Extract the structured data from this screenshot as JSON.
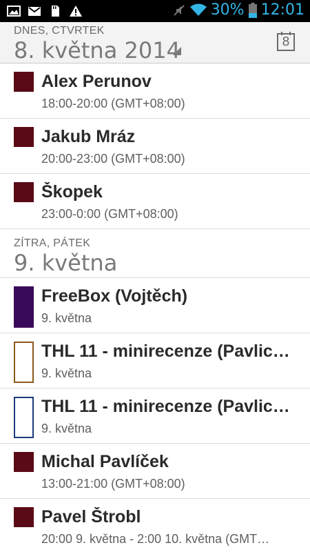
{
  "status_bar": {
    "icons_left": [
      "image-icon",
      "gmail-icon",
      "sd-card-icon",
      "warning-icon"
    ],
    "icons_right": [
      "mute-icon",
      "wifi-icon"
    ],
    "battery_percent": "30%",
    "time": "12:01",
    "accent_color": "#33b5e5"
  },
  "header": {
    "day_label": "DNES, CTVRTEK",
    "date_title": "8. května 2014",
    "today_number": "8"
  },
  "agenda": {
    "today_events": [
      {
        "title": "Alex Perunov",
        "when": "18:00-20:00 (GMT+08:00)",
        "color": "#5a0a16",
        "style": "square"
      },
      {
        "title": "Jakub Mráz",
        "when": "20:00-23:00 (GMT+08:00)",
        "color": "#5a0a16",
        "style": "square"
      },
      {
        "title": "Škopek",
        "when": "23:00-0:00 (GMT+08:00)",
        "color": "#5a0a16",
        "style": "square"
      }
    ],
    "tomorrow": {
      "day_label": "ZÍTRA, PÁTEK",
      "date_title": "9. května"
    },
    "tomorrow_events": [
      {
        "title": "FreeBox (Vojtěch)",
        "when": "9. května",
        "color": "#3a0a5a",
        "style": "tall"
      },
      {
        "title": "THL 11 - minirecenze (Pavlic…",
        "when": "9. května",
        "color": "#8a5a1a",
        "style": "outline"
      },
      {
        "title": "THL 11 - minirecenze (Pavlic…",
        "when": "9. května",
        "color": "#1a3a7a",
        "style": "outline"
      },
      {
        "title": "Michal Pavlíček",
        "when": "13:00-21:00 (GMT+08:00)",
        "color": "#5a0a16",
        "style": "square"
      },
      {
        "title": "Pavel Štrobl",
        "when": "20:00 9. května - 2:00 10. května (GMT…",
        "color": "#5a0a16",
        "style": "square"
      }
    ]
  }
}
